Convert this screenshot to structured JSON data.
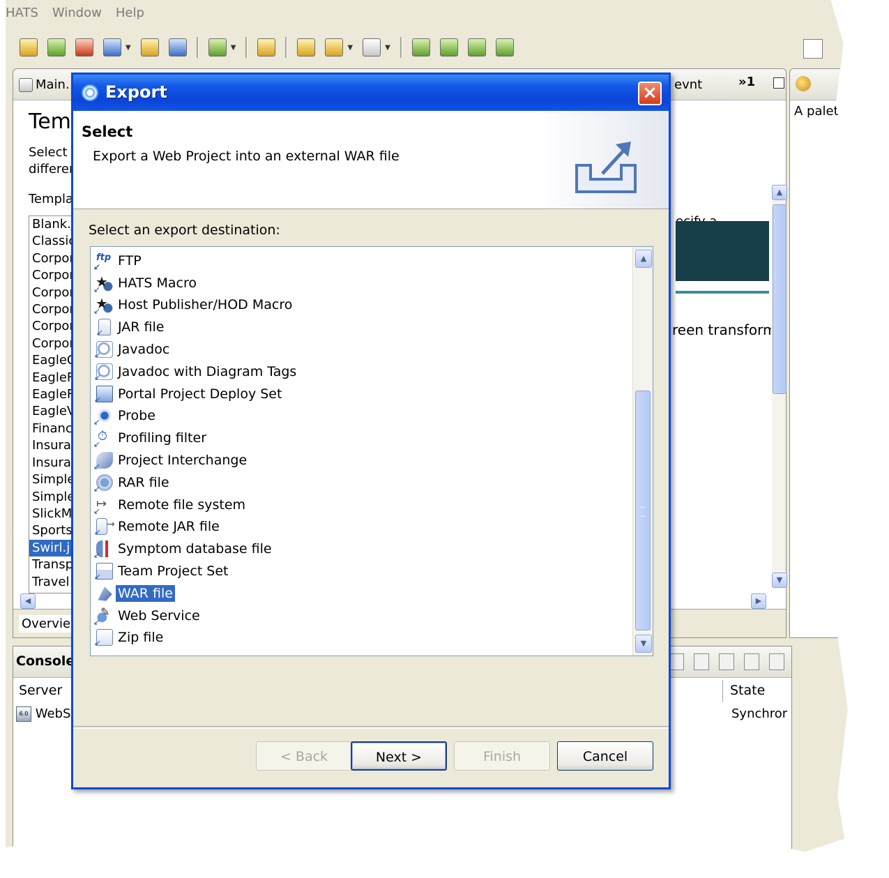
{
  "ide": {
    "menu": [
      "HATS",
      "Window",
      "Help"
    ],
    "editor_tab_label": "Main.",
    "editor_tab_right": "evnt",
    "tab_overflow": "»1",
    "editor_title": "Tem",
    "editor_desc_line1": "Select a",
    "editor_desc_line2": "differer",
    "editor_desc_right": "ecify a",
    "template_label": "Templa",
    "template_items": [
      "Blank.j",
      "Classic",
      "Corpor",
      "Corpor",
      "Corpor",
      "Corpor",
      "Corpor",
      "Corpor",
      "EagleC",
      "EagleF",
      "EagleF",
      "EagleV",
      "Financ",
      "Insura",
      "Insura",
      "Simple",
      "Simple",
      "SlickMo",
      "Sports",
      "Swirl.j",
      "Transp",
      "Travel"
    ],
    "template_selected_index": 19,
    "preview_text": "reen transform",
    "overview_tab": "Overview",
    "palette_text": "A palette",
    "console_title": "Console",
    "console_col_server": "Server",
    "console_col_state": "State",
    "console_row_server": "WebS",
    "console_row_state": "Synchror"
  },
  "dialog": {
    "title": "Export",
    "close_label": "×",
    "banner_title": "Select",
    "banner_desc": "Export a Web Project into an external WAR file",
    "destination_label": "Select an export destination:",
    "items": [
      {
        "label": "FTP",
        "icon": "ftp-icon"
      },
      {
        "label": "HATS Macro",
        "icon": "hats-macro-icon"
      },
      {
        "label": "Host Publisher/HOD Macro",
        "icon": "host-publisher-macro-icon"
      },
      {
        "label": "JAR file",
        "icon": "jar-file-icon"
      },
      {
        "label": "Javadoc",
        "icon": "javadoc-icon"
      },
      {
        "label": "Javadoc with Diagram Tags",
        "icon": "javadoc-diagram-icon"
      },
      {
        "label": "Portal Project Deploy Set",
        "icon": "portal-project-icon"
      },
      {
        "label": "Probe",
        "icon": "probe-icon"
      },
      {
        "label": "Profiling filter",
        "icon": "profiling-filter-icon"
      },
      {
        "label": "Project Interchange",
        "icon": "project-interchange-icon"
      },
      {
        "label": "RAR file",
        "icon": "rar-file-icon"
      },
      {
        "label": "Remote file system",
        "icon": "remote-file-system-icon"
      },
      {
        "label": "Remote JAR file",
        "icon": "remote-jar-icon"
      },
      {
        "label": "Symptom database file",
        "icon": "symptom-database-icon"
      },
      {
        "label": "Team Project Set",
        "icon": "team-project-set-icon"
      },
      {
        "label": "WAR file",
        "icon": "war-file-icon"
      },
      {
        "label": "Web Service",
        "icon": "web-service-icon"
      },
      {
        "label": "Zip file",
        "icon": "zip-file-icon"
      }
    ],
    "selected_index": 15,
    "buttons": {
      "back": "< Back",
      "next": "Next >",
      "finish": "Finish",
      "cancel": "Cancel"
    }
  },
  "colors": {
    "titlebar": "#0a45d8",
    "selection": "#316ac5",
    "dialog_face": "#ece9d8"
  }
}
